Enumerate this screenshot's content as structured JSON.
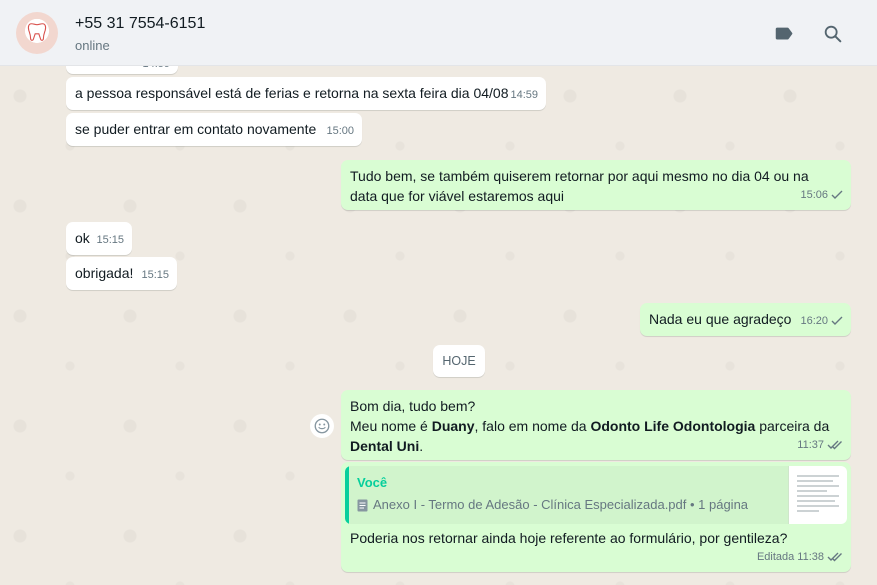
{
  "header": {
    "contact_name": "+55 31 7554-6151",
    "status": "online",
    "icons": [
      "label-icon",
      "search-icon"
    ]
  },
  "messages": [
    {
      "dir": "in",
      "text": "",
      "time": "14:59"
    },
    {
      "dir": "in",
      "text": "a pessoa responsável está de ferias e retorna na sexta feira dia 04/08",
      "time": "14:59"
    },
    {
      "dir": "in",
      "text": "se puder entrar em contato novamente",
      "time": "15:00"
    },
    {
      "dir": "out",
      "line1": "Tudo bem, se também quiserem retornar por aqui mesmo no dia 04 ou na",
      "line2": "data que for viável estaremos aqui",
      "time": "15:06"
    },
    {
      "dir": "in",
      "text": "ok",
      "time": "15:15"
    },
    {
      "dir": "in",
      "text": "obrigada!",
      "time": "15:15"
    },
    {
      "dir": "out",
      "text": "Nada eu que agradeço",
      "time": "16:20"
    }
  ],
  "day_divider": "HOJE",
  "msg_intro": {
    "line1": "Bom dia, tudo bem?",
    "l2_a": "Meu nome é ",
    "l2_b": "Duany",
    "l2_c": ", falo em nome da ",
    "l2_d": "Odonto Life Odontologia",
    "l2_e": " parceira da",
    "l3_a": "Dental Uni",
    "l3_b": ".",
    "time": "11:37"
  },
  "msg_reply": {
    "quote_author": "Você",
    "quote_file": "Anexo I - Termo de Adesão - Clínica Especializada.pdf • 1 página",
    "text": "Poderia nos retornar ainda hoje referente ao formulário, por gentileza?",
    "edited": "Editada",
    "time": "11:38"
  },
  "colors": {
    "outgoing": "#d9fdd3",
    "incoming": "#ffffff",
    "accent": "#06cf9c",
    "tick_read": "#667781"
  }
}
